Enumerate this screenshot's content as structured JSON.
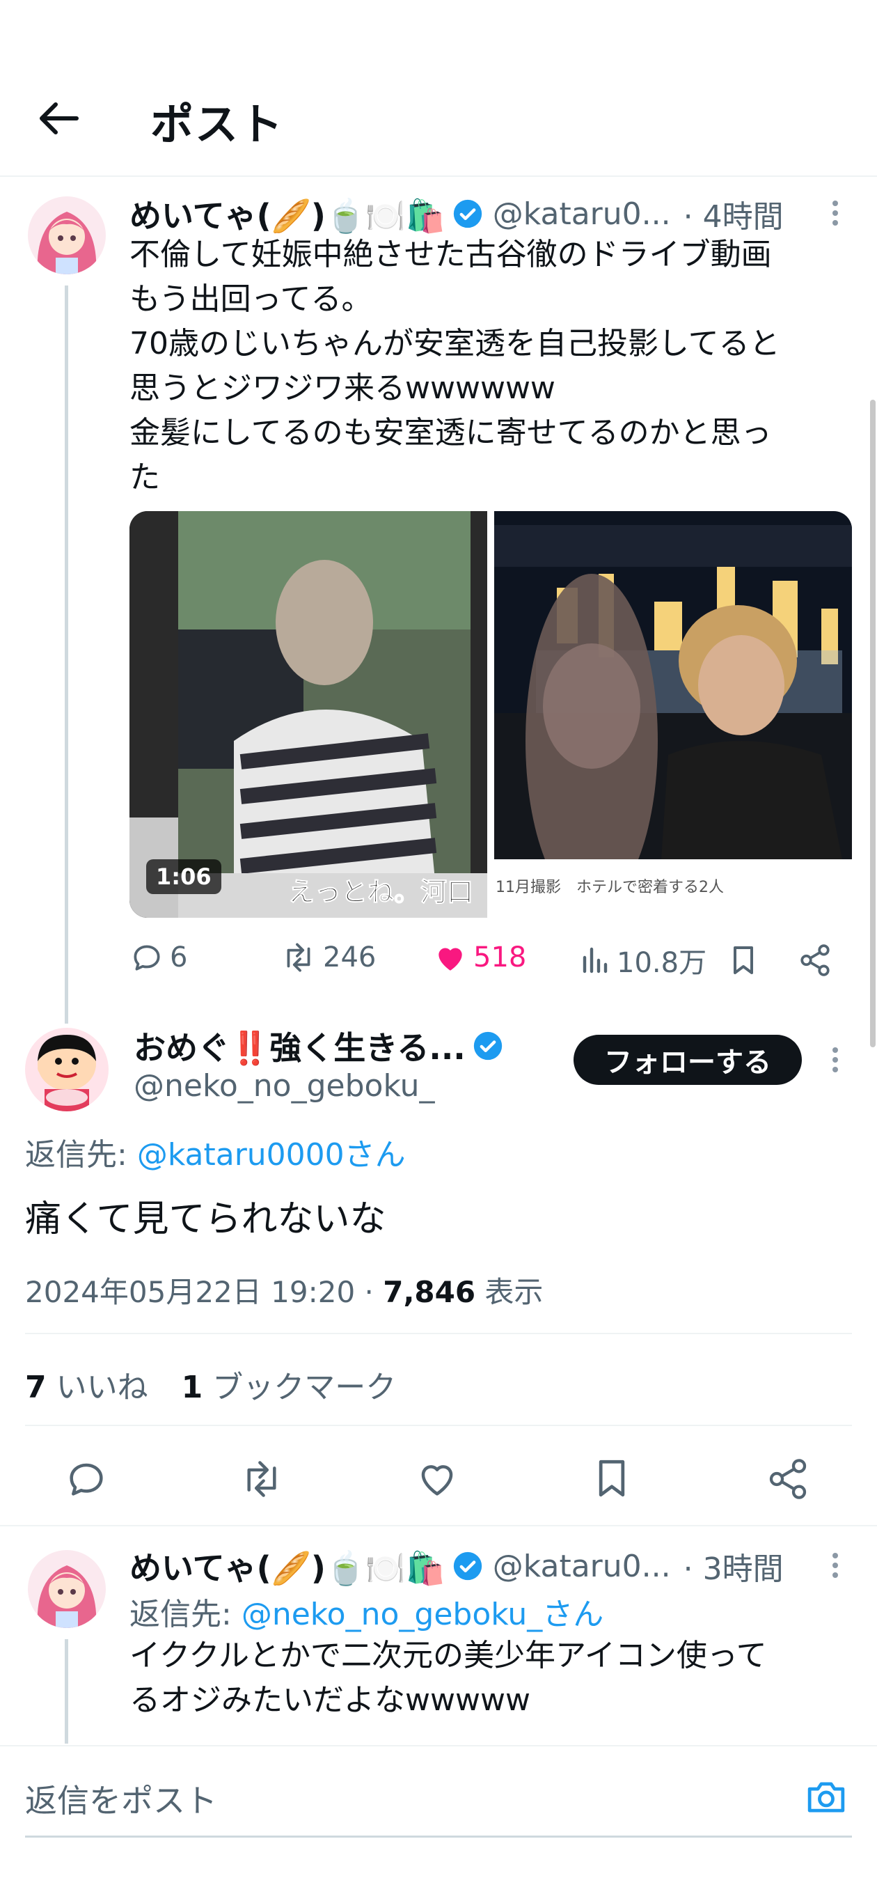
{
  "header": {
    "title": "ポスト"
  },
  "colors": {
    "accent": "#1d9bf0",
    "like": "#f91880",
    "text": "#0f1419",
    "muted": "#536471"
  },
  "post1": {
    "display_name": "めいてゃ(🥖)🍵🍽️🛍️",
    "handle": "@kataru0...",
    "time": "· 4時間",
    "text": "不倫して妊娠中絶させた古谷徹のドライブ動画\nもう出回ってる。\n70歳のじいちゃんが安室透を自己投影してると\n思うとジワジワ来るwwwwww\n金髪にしてるのも安室透に寄せてるのかと思っ\nた",
    "video": {
      "duration": "1:06",
      "caption": "えっとね。河口"
    },
    "photo": {
      "caption": "11月撮影　ホテルで密着する2人"
    },
    "actions": {
      "replies": "6",
      "reposts": "246",
      "likes": "518",
      "views": "10.8万"
    }
  },
  "focus_post": {
    "display_name": "おめぐ‼️強く生きる...",
    "handle": "@neko_no_geboku_",
    "follow_label": "フォローする",
    "reply_prefix": "返信先: ",
    "reply_to": "@kataru0000さん",
    "text": "痛くて見てられないな",
    "date": "2024年05月22日 19:20 · ",
    "views_count": "7,846",
    "views_label": " 表示",
    "likes_count": "7",
    "likes_label": " いいね",
    "bookmarks_count": "1",
    "bookmarks_label": " ブックマーク"
  },
  "post3": {
    "display_name": "めいてゃ(🥖)🍵🍽️🛍️",
    "handle": "@kataru0...",
    "time": "· 3時間",
    "reply_prefix": "返信先: ",
    "reply_to": "@neko_no_geboku_さん",
    "text": "イククルとかで二次元の美少年アイコン使って\nるオジみたいだよなwwwww"
  },
  "composer": {
    "placeholder": "返信をポスト"
  }
}
